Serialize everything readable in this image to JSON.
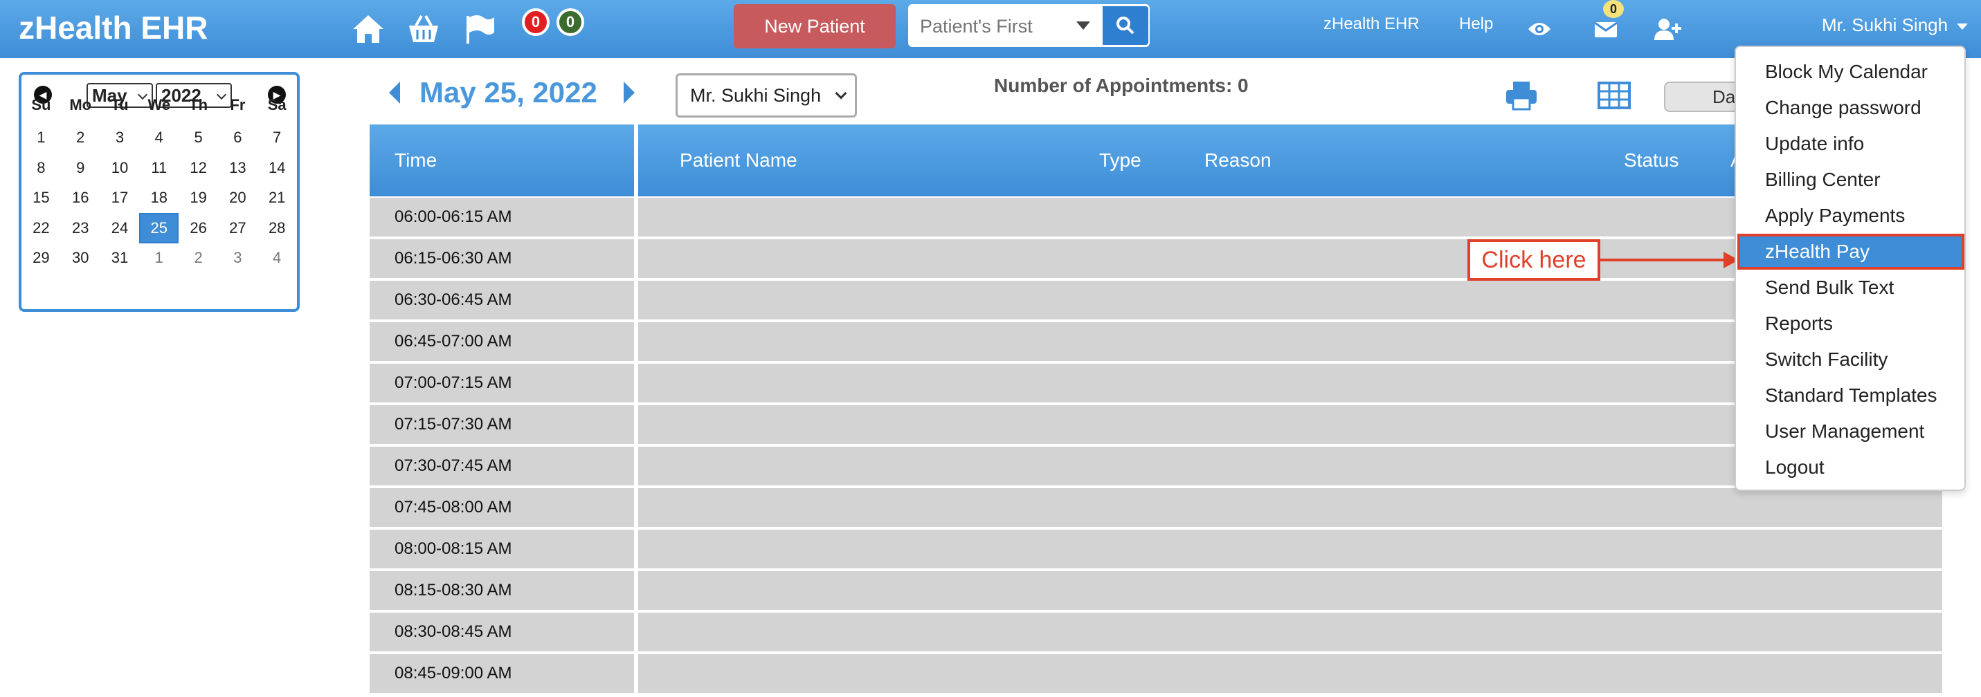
{
  "app": {
    "title": "zHealth EHR"
  },
  "header": {
    "notification_counts": [
      "0",
      "0"
    ],
    "new_patient_label": "New Patient",
    "search": {
      "placeholder": "Patient's First"
    },
    "links": {
      "app_name": "zHealth EHR",
      "help": "Help"
    },
    "mail_count": "0",
    "user_name": "Mr. Sukhi Singh"
  },
  "calendar": {
    "month": "May",
    "year": "2022",
    "days_of_week": [
      "Su",
      "Mo",
      "Tu",
      "We",
      "Th",
      "Fr",
      "Sa"
    ],
    "weeks": [
      [
        "1",
        "2",
        "3",
        "4",
        "5",
        "6",
        "7"
      ],
      [
        "8",
        "9",
        "10",
        "11",
        "12",
        "13",
        "14"
      ],
      [
        "15",
        "16",
        "17",
        "18",
        "19",
        "20",
        "21"
      ],
      [
        "22",
        "23",
        "24",
        "25",
        "26",
        "27",
        "28"
      ],
      [
        "29",
        "30",
        "31",
        "1",
        "2",
        "3",
        "4"
      ]
    ],
    "selected_day": "25"
  },
  "schedule": {
    "date_label": "May 25, 2022",
    "provider": "Mr. Sukhi Singh",
    "appointment_count_label": "Number of Appointments: 0",
    "view_button": "Day",
    "columns": {
      "time": "Time",
      "patient_name": "Patient Name",
      "type": "Type",
      "reason": "Reason",
      "status": "Status",
      "extra": "A"
    },
    "time_slots": [
      "06:00-06:15 AM",
      "06:15-06:30 AM",
      "06:30-06:45 AM",
      "06:45-07:00 AM",
      "07:00-07:15 AM",
      "07:15-07:30 AM",
      "07:30-07:45 AM",
      "07:45-08:00 AM",
      "08:00-08:15 AM",
      "08:15-08:30 AM",
      "08:30-08:45 AM",
      "08:45-09:00 AM"
    ]
  },
  "user_dropdown": {
    "items": [
      "Block My Calendar",
      "Change password",
      "Update info",
      "Billing Center",
      "Apply Payments",
      "zHealth Pay",
      "Send Bulk Text",
      "Reports",
      "Switch Facility",
      "Standard Templates",
      "User Management",
      "Logout"
    ],
    "active_item": "zHealth Pay"
  },
  "annotation": {
    "callout_text": "Click here"
  },
  "colors": {
    "header_blue": "#3e8dd6",
    "new_patient_red": "#c65a5c",
    "callout_red": "#e0402a",
    "row_gray": "#d3d3d3"
  }
}
